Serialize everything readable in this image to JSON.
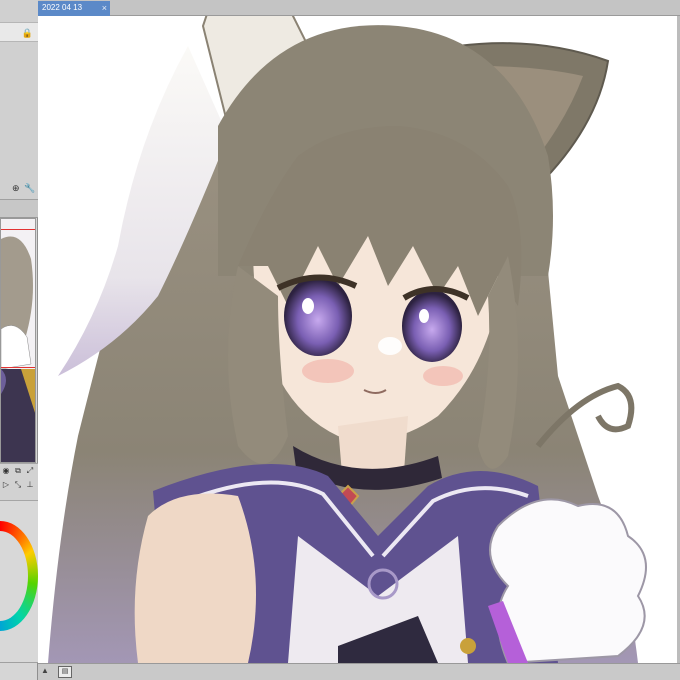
{
  "document_tab": {
    "title": "2022 04 13",
    "close_glyph": "×"
  },
  "icons": {
    "lock": "lock-icon",
    "close": "close-icon",
    "arrow_up": "arrow-up-icon",
    "layer": "layer-icon"
  },
  "glyphs": {
    "lock": "🔒",
    "arrow_up": "▲",
    "layer": "▤",
    "navtools": [
      "◉",
      "⧉",
      "⤢",
      "▷",
      "⤡",
      "⊥"
    ],
    "panel_icons": [
      "⊕",
      "🔧"
    ]
  },
  "colors": {
    "tab_active": "#5b89c8",
    "navigator_marker": "#e23232",
    "hair": "#8d8577",
    "uniform": "#5f5290",
    "eyes": "#7a5fb3"
  }
}
